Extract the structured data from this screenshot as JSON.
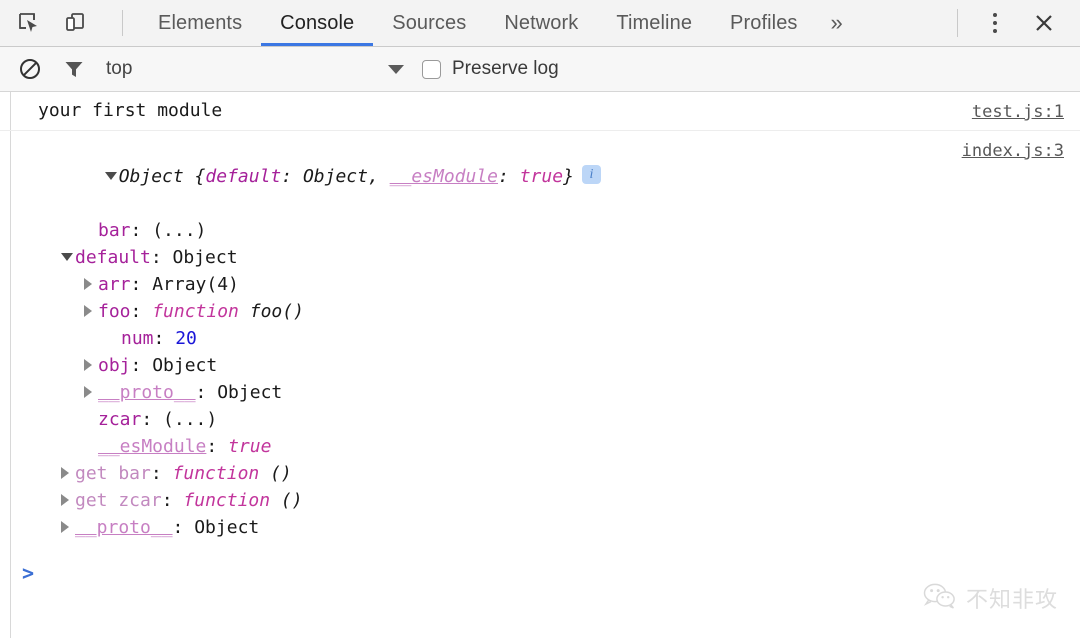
{
  "theme": {
    "accent": "#3b77e3",
    "prompt_color": "#3b6fd4",
    "info_badge_bg": "#bcd6f7"
  },
  "tabbar": {
    "inspect_icon": "inspect-element-icon",
    "device_icon": "device-toolbar-icon",
    "tabs": [
      {
        "label": "Elements",
        "active": false
      },
      {
        "label": "Console",
        "active": true
      },
      {
        "label": "Sources",
        "active": false
      },
      {
        "label": "Network",
        "active": false
      },
      {
        "label": "Timeline",
        "active": false
      },
      {
        "label": "Profiles",
        "active": false
      }
    ],
    "more_tabs_label": "»",
    "menu_icon": "kebab-menu-icon",
    "close_icon": "close-icon",
    "close_label": "✕"
  },
  "filterbar": {
    "clear_icon": "clear-console-icon",
    "filter_icon": "filter-icon",
    "context_value": "top",
    "context_caret": "chevron-down-icon",
    "preserve_log_label": "Preserve log",
    "preserve_log_checked": false
  },
  "console": {
    "messages": [
      {
        "type": "log",
        "text": "your first module",
        "source": "test.js:1"
      },
      {
        "type": "object",
        "source": "index.js:3",
        "badge": "i"
      }
    ],
    "object_header": {
      "arrow": "down",
      "parts": [
        {
          "text": "Object {",
          "cls": "t-plain t-it"
        },
        {
          "text": "default",
          "cls": "t-prop t-it"
        },
        {
          "text": ": Object, ",
          "cls": "t-plain t-it"
        },
        {
          "text": "__esModule",
          "cls": "t-intern t-it"
        },
        {
          "text": ": ",
          "cls": "t-plain t-it"
        },
        {
          "text": "true",
          "cls": "t-kw"
        },
        {
          "text": "}",
          "cls": "t-plain t-it"
        }
      ]
    },
    "tree_rows": [
      {
        "indent": 2,
        "arrow": "none",
        "parts": [
          {
            "text": "bar",
            "cls": "t-prop"
          },
          {
            "text": ": (...)",
            "cls": "t-plain"
          }
        ]
      },
      {
        "indent": 1,
        "arrow": "down",
        "parts": [
          {
            "text": "default",
            "cls": "t-prop"
          },
          {
            "text": ": Object",
            "cls": "t-plain"
          }
        ]
      },
      {
        "indent": 2,
        "arrow": "right",
        "parts": [
          {
            "text": "arr",
            "cls": "t-prop"
          },
          {
            "text": ": Array(4)",
            "cls": "t-plain"
          }
        ]
      },
      {
        "indent": 2,
        "arrow": "right",
        "parts": [
          {
            "text": "foo",
            "cls": "t-prop"
          },
          {
            "text": ": ",
            "cls": "t-plain"
          },
          {
            "text": "function",
            "cls": "t-kw"
          },
          {
            "text": " foo()",
            "cls": "t-plain t-it"
          }
        ]
      },
      {
        "indent": 3,
        "arrow": "none",
        "parts": [
          {
            "text": "num",
            "cls": "t-prop"
          },
          {
            "text": ": ",
            "cls": "t-plain"
          },
          {
            "text": "20",
            "cls": "t-num"
          }
        ]
      },
      {
        "indent": 2,
        "arrow": "right",
        "parts": [
          {
            "text": "obj",
            "cls": "t-prop"
          },
          {
            "text": ": Object",
            "cls": "t-plain"
          }
        ]
      },
      {
        "indent": 2,
        "arrow": "right",
        "parts": [
          {
            "text": "__proto__",
            "cls": "t-intern"
          },
          {
            "text": ": Object",
            "cls": "t-plain"
          }
        ]
      },
      {
        "indent": 2,
        "arrow": "none",
        "parts": [
          {
            "text": "zcar",
            "cls": "t-prop"
          },
          {
            "text": ": (...)",
            "cls": "t-plain"
          }
        ]
      },
      {
        "indent": 2,
        "arrow": "none",
        "parts": [
          {
            "text": "__esModule",
            "cls": "t-intern"
          },
          {
            "text": ": ",
            "cls": "t-plain"
          },
          {
            "text": "true",
            "cls": "t-kw"
          }
        ]
      },
      {
        "indent": 1,
        "arrow": "right",
        "parts": [
          {
            "text": "get bar",
            "cls": "t-getter"
          },
          {
            "text": ": ",
            "cls": "t-plain"
          },
          {
            "text": "function",
            "cls": "t-kw"
          },
          {
            "text": " ()",
            "cls": "t-plain t-it"
          }
        ]
      },
      {
        "indent": 1,
        "arrow": "right",
        "parts": [
          {
            "text": "get zcar",
            "cls": "t-getter"
          },
          {
            "text": ": ",
            "cls": "t-plain"
          },
          {
            "text": "function",
            "cls": "t-kw"
          },
          {
            "text": " ()",
            "cls": "t-plain t-it"
          }
        ]
      },
      {
        "indent": 1,
        "arrow": "right",
        "parts": [
          {
            "text": "__proto__",
            "cls": "t-intern"
          },
          {
            "text": ": Object",
            "cls": "t-plain"
          }
        ]
      }
    ],
    "prompt_symbol": ">"
  },
  "watermark": {
    "icon": "wechat-logo-icon",
    "text": "不知非攻"
  }
}
